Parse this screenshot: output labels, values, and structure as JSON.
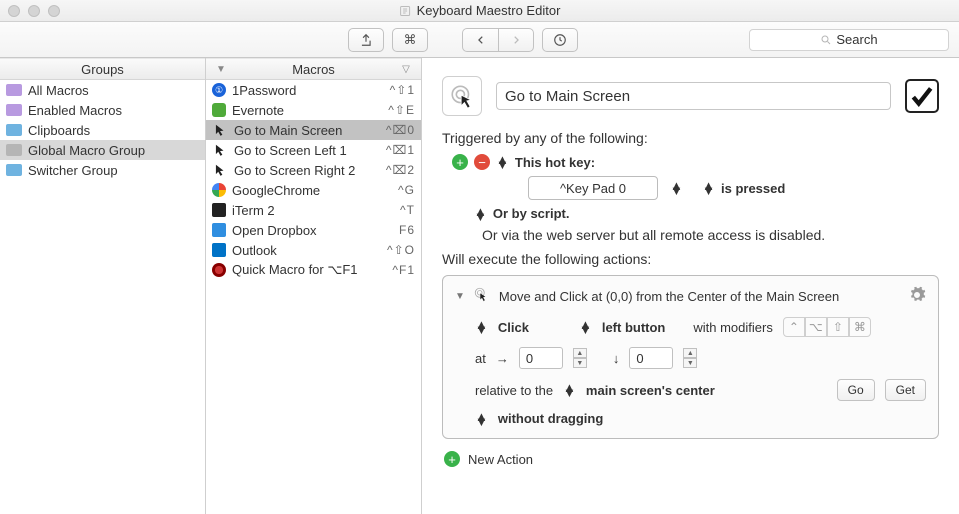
{
  "window": {
    "title": "Keyboard Maestro Editor"
  },
  "toolbar": {
    "search_placeholder": "Search"
  },
  "groups": {
    "header": "Groups",
    "items": [
      {
        "name": "All Macros",
        "color": "f-purple"
      },
      {
        "name": "Enabled Macros",
        "color": "f-purple"
      },
      {
        "name": "Clipboards",
        "color": "f-blue"
      },
      {
        "name": "Global Macro Group",
        "color": "f-grey",
        "selected": true
      },
      {
        "name": "Switcher Group",
        "color": "f-blue"
      }
    ]
  },
  "macros": {
    "header": "Macros",
    "items": [
      {
        "name": "1Password",
        "shortcut": "^⇧1",
        "icon": "1p"
      },
      {
        "name": "Evernote",
        "shortcut": "^⇧E",
        "icon": "ev"
      },
      {
        "name": "Go to Main Screen",
        "shortcut": "^⌧0",
        "icon": "cursor",
        "selected": true
      },
      {
        "name": "Go to Screen Left 1",
        "shortcut": "^⌧1",
        "icon": "cursor"
      },
      {
        "name": "Go to Screen Right 2",
        "shortcut": "^⌧2",
        "icon": "cursor"
      },
      {
        "name": "GoogleChrome",
        "shortcut": "^G",
        "icon": "gc"
      },
      {
        "name": "iTerm 2",
        "shortcut": "^T",
        "icon": "it"
      },
      {
        "name": "Open Dropbox",
        "shortcut": "F6",
        "icon": "db"
      },
      {
        "name": "Outlook",
        "shortcut": "^⇧O",
        "icon": "ol"
      },
      {
        "name": "Quick Macro for ⌥F1",
        "shortcut": "^F1",
        "icon": "qm"
      }
    ]
  },
  "detail": {
    "name": "Go to Main Screen",
    "trigger_heading": "Triggered by any of the following:",
    "hotkey_label": "This hot key:",
    "hotkey_value": "^Key Pad 0",
    "hotkey_state": "is pressed",
    "or_script": "Or by script.",
    "webserver_note": "Or via the web server but all remote access is disabled.",
    "actions_heading": "Will execute the following actions:",
    "action": {
      "title": "Move and Click at (0,0) from the Center of the Main Screen",
      "click_label": "Click",
      "button_label": "left button",
      "modifiers_label": "with modifiers",
      "at_label": "at",
      "x": "0",
      "y": "0",
      "relative_label": "relative to the",
      "relative_value": "main screen's center",
      "go": "Go",
      "get": "Get",
      "drag_label": "without dragging"
    },
    "new_action": "New Action"
  }
}
